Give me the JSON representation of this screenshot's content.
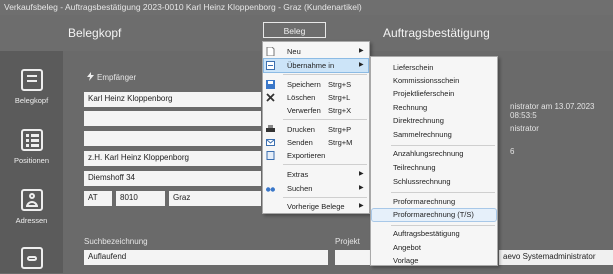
{
  "window": {
    "title": "Verkaufsbeleg - Auftragsbestätigung 2023-0010 Karl Heinz Kloppenborg - Graz (Kundenartikel)"
  },
  "header": {
    "left_title": "Belegkopf",
    "right_title": "Auftragsbestätigung",
    "beleg_button": "Beleg"
  },
  "sidebar": {
    "items": [
      {
        "label": "Belegkopf",
        "icon": "document-icon"
      },
      {
        "label": "Positionen",
        "icon": "list-icon"
      },
      {
        "label": "Adressen",
        "icon": "person-icon"
      },
      {
        "label": "",
        "icon": "handshake-icon"
      }
    ]
  },
  "form": {
    "empfaenger_label": "Empfänger",
    "name": "Karl Heinz Kloppenborg",
    "line2": "",
    "line3": "",
    "attention": "z.H. Karl Heinz Kloppenborg",
    "street": "Diemshoff 34",
    "country": "AT",
    "zip": "8010",
    "city": "Graz",
    "suchbezeichnung_label": "Suchbezeichnung",
    "suchbezeichnung": "Auflaufend",
    "projekt_label": "Projekt",
    "projekt": ""
  },
  "background_right": {
    "line1": "nistrator am 13.07.2023 08:53:5",
    "line2": "nistrator",
    "line3": "6",
    "line4": "aevo Systemadministrator"
  },
  "menu": {
    "items": [
      {
        "label": "Neu",
        "shortcut": "",
        "submenu": true,
        "icon": "new-file-icon"
      },
      {
        "label": "Übernahme in",
        "shortcut": "",
        "submenu": true,
        "icon": "transfer-icon",
        "active": true
      },
      {
        "label": "Speichern",
        "shortcut": "Strg+S",
        "submenu": false,
        "icon": "save-icon"
      },
      {
        "label": "Löschen",
        "shortcut": "Strg+L",
        "submenu": false,
        "icon": "delete-icon"
      },
      {
        "label": "Verwerfen",
        "shortcut": "Strg+X",
        "submenu": false,
        "icon": ""
      },
      {
        "label": "Drucken",
        "shortcut": "Strg+P",
        "submenu": false,
        "icon": "printer-icon"
      },
      {
        "label": "Senden",
        "shortcut": "Strg+M",
        "submenu": false,
        "icon": "mail-icon"
      },
      {
        "label": "Exportieren",
        "shortcut": "",
        "submenu": false,
        "icon": "export-icon"
      },
      {
        "label": "Extras",
        "shortcut": "",
        "submenu": true,
        "icon": ""
      },
      {
        "label": "Suchen",
        "shortcut": "",
        "submenu": true,
        "icon": "binoculars-icon"
      },
      {
        "label": "Vorherige Belege",
        "shortcut": "",
        "submenu": true,
        "icon": ""
      }
    ]
  },
  "submenu": {
    "items": [
      "Lieferschein",
      "Kommissionsschein",
      "Projektlieferschein",
      "Rechnung",
      "Direktrechnung",
      "Sammelrechnung",
      "Anzahlungsrechnung",
      "Teilrechnung",
      "Schlussrechnung",
      "Proformarechnung",
      "Proformarechnung (T/S)",
      "Auftragsbestätigung",
      "Angebot",
      "Vorlage"
    ]
  },
  "colors": {
    "menu_bg": "#f6f6f6",
    "active_bg": "#cce4f8",
    "panel_bg": "#6a6a6a"
  }
}
